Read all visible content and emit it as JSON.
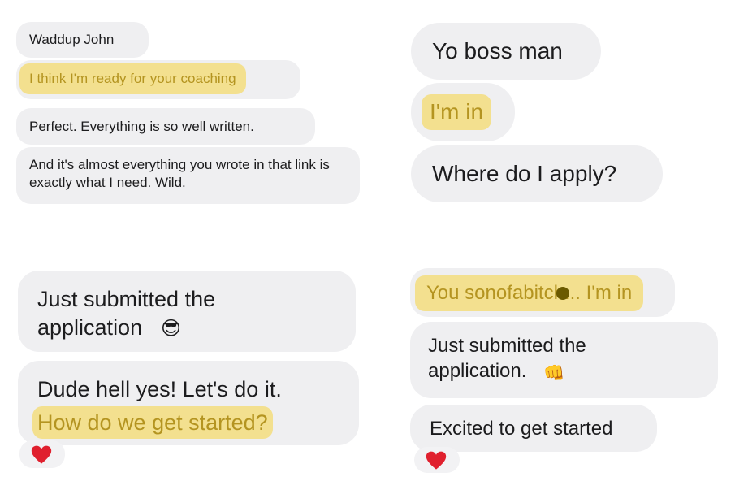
{
  "panel_tl": {
    "m1": "Waddup John",
    "m2": "I think I'm ready for your coaching",
    "m3": "Perfect. Everything is so well written.",
    "m4": "And it's almost everything you wrote in that link is exactly what I need. Wild."
  },
  "panel_tr": {
    "m1": "Yo boss man",
    "m2": "I'm in",
    "m3": "Where do I apply?"
  },
  "panel_bl": {
    "m1": "Just submitted the application",
    "m1_emoji": "😎",
    "m2": "Dude hell yes! Let's do it.",
    "m2_highlight": "How do we get started?",
    "reaction": "heart"
  },
  "panel_br": {
    "m1": "You sonofabitch... I'm in",
    "m2": "Just submitted the application.",
    "m2_emoji": "👊",
    "m3": "Excited to get started",
    "reaction": "heart"
  },
  "colors": {
    "bubble": "#efeff1",
    "highlight": "#f3e08f",
    "highlight_text": "#b49420",
    "heart": "#e0202e"
  }
}
